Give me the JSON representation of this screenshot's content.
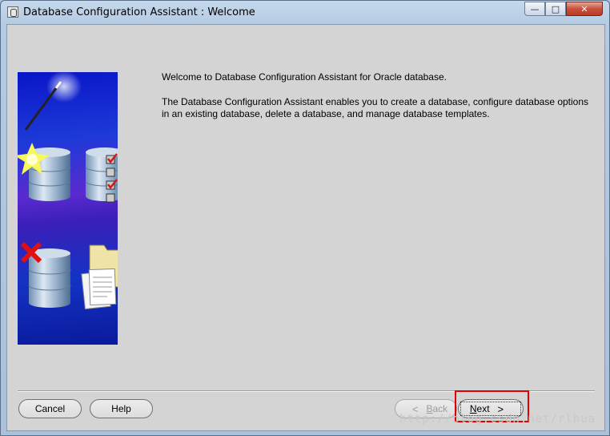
{
  "window": {
    "title": "Database Configuration Assistant : Welcome",
    "controls": {
      "minimize": "—",
      "maximize": "□",
      "close": "✕"
    }
  },
  "content": {
    "welcome": "Welcome to Database Configuration Assistant for Oracle database.",
    "description": "The Database Configuration Assistant enables you to create a database, configure database options in an existing database, delete a database, and manage database templates."
  },
  "buttons": {
    "cancel": "Cancel",
    "help": "Help",
    "back_mnemonic": "B",
    "back_rest": "ack",
    "back_chevron": "<",
    "next_mnemonic": "N",
    "next_rest": "ext",
    "next_chevron": ">"
  },
  "watermark": "http://blog.csdn.net/rlhua",
  "colors": {
    "highlight": "#e00000",
    "illustration_bg": "#1433c4"
  }
}
